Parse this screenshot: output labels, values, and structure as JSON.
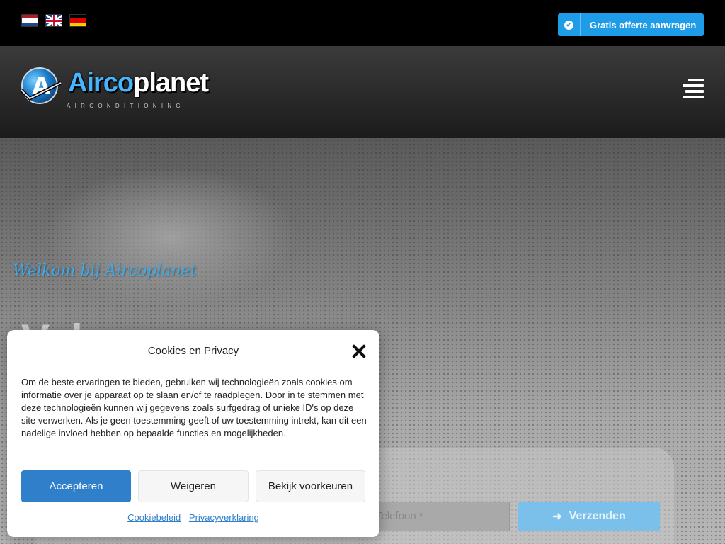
{
  "topbar": {
    "flags": [
      {
        "name": "nl-flag-icon",
        "colors": [
          "#ae1c28",
          "#ffffff",
          "#21468b"
        ]
      },
      {
        "name": "en-flag-icon"
      },
      {
        "name": "de-flag-icon",
        "colors": [
          "#000000",
          "#dd0000",
          "#ffce00"
        ]
      }
    ],
    "quote_button": {
      "icon": "check-circle-icon",
      "label": "Gratis offerte aanvragen"
    }
  },
  "header": {
    "logo": {
      "part1": "Airco",
      "part2": "planet",
      "subtitle": "AIRCONDITIONING"
    },
    "menu_icon": "hamburger-menu-icon"
  },
  "hero": {
    "welcome": "Welkom bij Aircoplanet",
    "heading": "Vak",
    "form": {
      "phone_placeholder": "Telefoon *",
      "send_label": "Verzenden",
      "send_icon": "arrow-right-icon"
    }
  },
  "cookie_modal": {
    "title": "Cookies en Privacy",
    "body": "Om de beste ervaringen te bieden, gebruiken wij technologieën zoals cookies om informatie over je apparaat op te slaan en/of te raadplegen. Door in te stemmen met deze technologieën kunnen wij gegevens zoals surfgedrag of unieke ID's op deze site verwerken. Als je geen toestemming geeft of uw toestemming intrekt, kan dit een nadelige invloed hebben op bepaalde functies en mogelijkheden.",
    "accept": "Accepteren",
    "deny": "Weigeren",
    "prefs": "Bekijk voorkeuren",
    "link_cookie": "Cookiebeleid",
    "link_privacy": "Privacyverklaring"
  },
  "colors": {
    "accent": "#1e9ce8",
    "modal_primary": "#2f7fcb"
  }
}
